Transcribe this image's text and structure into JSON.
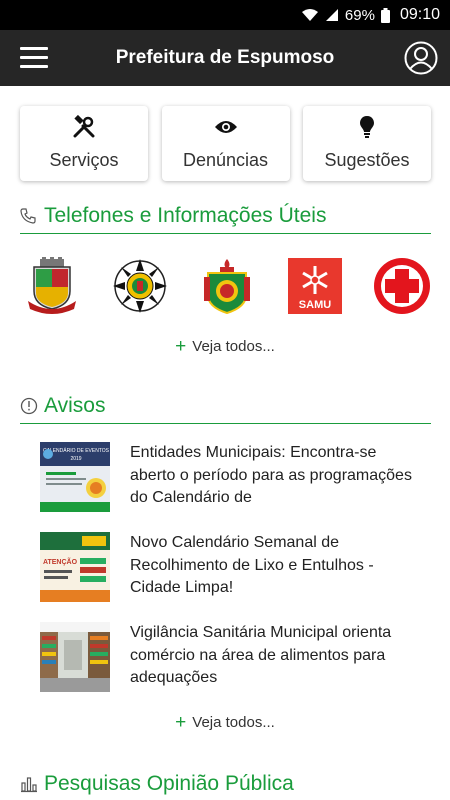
{
  "status": {
    "battery": "69%",
    "time": "09:10"
  },
  "header": {
    "title": "Prefeitura de Espumoso"
  },
  "quick_actions": [
    {
      "label": "Serviços",
      "icon": "tools-icon"
    },
    {
      "label": "Denúncias",
      "icon": "eye-icon"
    },
    {
      "label": "Sugestões",
      "icon": "lightbulb-icon"
    }
  ],
  "phones": {
    "title": "Telefones e Informações Úteis",
    "logos": [
      {
        "name": "municipal-coat-of-arms"
      },
      {
        "name": "state-coat-of-arms"
      },
      {
        "name": "fire-brigade-emblem"
      },
      {
        "name": "samu-logo",
        "text": "SAMU"
      },
      {
        "name": "red-cross-logo"
      }
    ],
    "more": "Veja todos..."
  },
  "notices": {
    "title": "Avisos",
    "items": [
      {
        "text": "Entidades Municipais: Encontra-se aberto o período para as programações do Calendário de",
        "thumb_title": "CALENDÁRIO DE EVENTOS",
        "thumb_year": "2019"
      },
      {
        "text": "Novo Calendário Semanal de Recolhimento de Lixo e Entulhos - Cidade Limpa!",
        "thumb_title": "ATENÇÃO"
      },
      {
        "text": "Vigilância Sanitária Municipal orienta comércio na área de alimentos para adequações"
      }
    ],
    "more": "Veja todos..."
  },
  "polls": {
    "title": "Pesquisas Opinião Pública"
  },
  "colors": {
    "accent": "#1a9c3c",
    "appbar": "#262626",
    "samu": "#e8382d",
    "red_cross": "#e3151d"
  }
}
